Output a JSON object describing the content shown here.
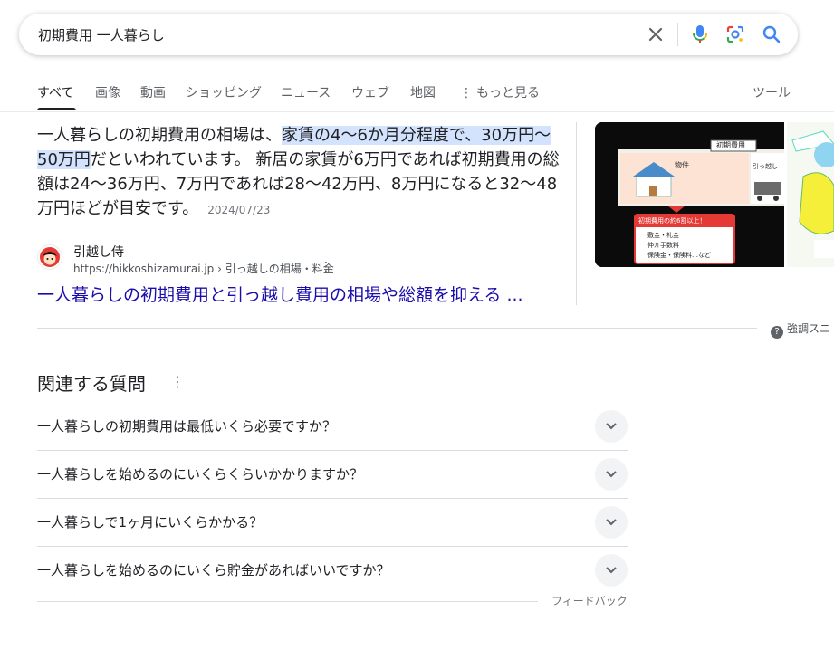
{
  "search": {
    "query": "初期費用 一人暮らし",
    "clear_icon": "close-icon",
    "voice_icon": "mic-icon",
    "lens_icon": "lens-icon",
    "search_icon": "search-icon"
  },
  "tabs": [
    "すべて",
    "画像",
    "動画",
    "ショッピング",
    "ニュース",
    "ウェブ",
    "地図",
    "もっと見る"
  ],
  "more_icon": "more-vert-icon",
  "tools_label": "ツール",
  "snippet": {
    "lead": "一人暮らしの初期費用の相場は、",
    "highlight": "家賃の4〜6か月分程度で、30万円〜50万円",
    "rest": "だといわれています。 新居の家賃が6万円であれば初期費用の総額は24〜36万円、7万円であれば28〜42万円、8万円になると32〜48万円ほどが目安です。",
    "date": "2024/07/23"
  },
  "source": {
    "name": "引越し侍",
    "url": "https://hikkoshizamurai.jp",
    "breadcrumb": "› 引っ越しの相場・料金",
    "title": "一人暮らしの初期費用と引っ越し費用の相場や総額を抑える ..."
  },
  "image1": {
    "header": "初期費用",
    "item1": "物件",
    "item2": "引っ越し",
    "box_title": "初期費用の約6割以上！",
    "bullets": [
      "敷金・礼金",
      "仲介手数料",
      "保険金・保険料…など"
    ]
  },
  "about_snippet_label": "強調スニ",
  "related": {
    "title": "関連する質問",
    "questions": [
      "一人暮らしの初期費用は最低いくら必要ですか？",
      "一人暮らしを始めるのにいくらくらいかかりますか？",
      "一人暮らしで1ヶ月にいくらかかる？",
      "一人暮らしを始めるのにいくら貯金があればいいですか？"
    ],
    "feedback": "フィードバック"
  },
  "colors": {
    "link": "#1a0dab",
    "highlight": "#d3e3fd",
    "text": "#202124",
    "muted": "#5f6368"
  }
}
